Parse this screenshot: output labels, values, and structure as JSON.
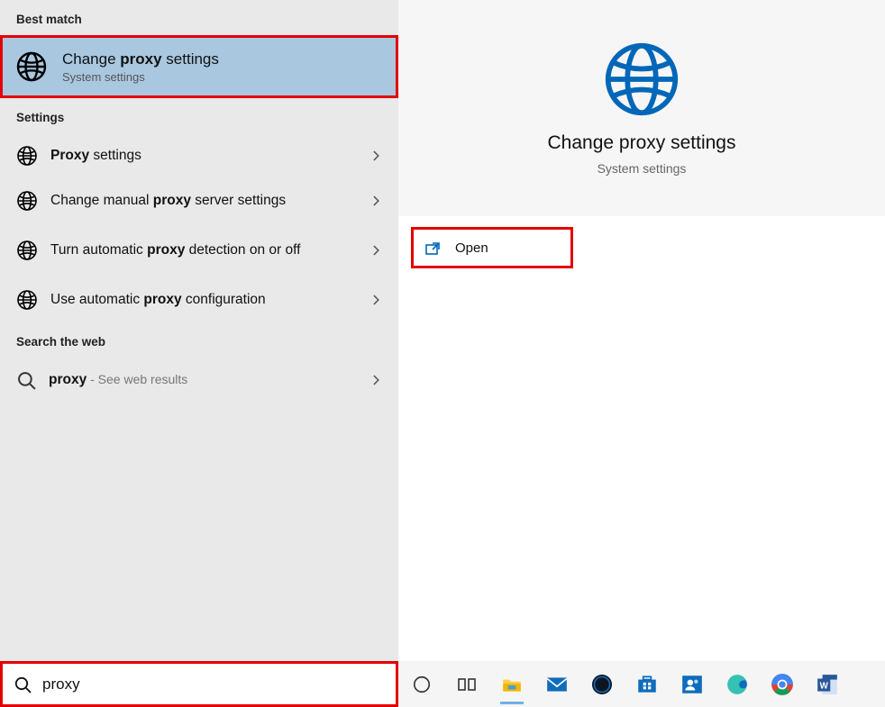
{
  "sections": {
    "best_match": "Best match",
    "settings": "Settings",
    "search_web": "Search the web"
  },
  "best_match_item": {
    "title_pre": "Change ",
    "title_bold": "proxy",
    "title_post": " settings",
    "subtitle": "System settings"
  },
  "settings_items": [
    {
      "pre": "",
      "bold": "Proxy",
      "post": " settings"
    },
    {
      "pre": "Change manual ",
      "bold": "proxy",
      "post": " server settings"
    },
    {
      "pre": "Turn automatic ",
      "bold": "proxy",
      "post": " detection on or off"
    },
    {
      "pre": "Use automatic ",
      "bold": "proxy",
      "post": " configuration"
    }
  ],
  "web_item": {
    "bold": "proxy",
    "suffix": " - See web results"
  },
  "preview": {
    "title": "Change proxy settings",
    "subtitle": "System settings"
  },
  "action": {
    "open": "Open"
  },
  "search": {
    "value": "proxy"
  },
  "taskbar_icons": [
    "cortana-circle-icon",
    "task-view-icon",
    "file-explorer-icon",
    "mail-icon",
    "dell-icon",
    "store-icon",
    "people-icon",
    "edge-icon",
    "chrome-icon",
    "word-icon"
  ]
}
